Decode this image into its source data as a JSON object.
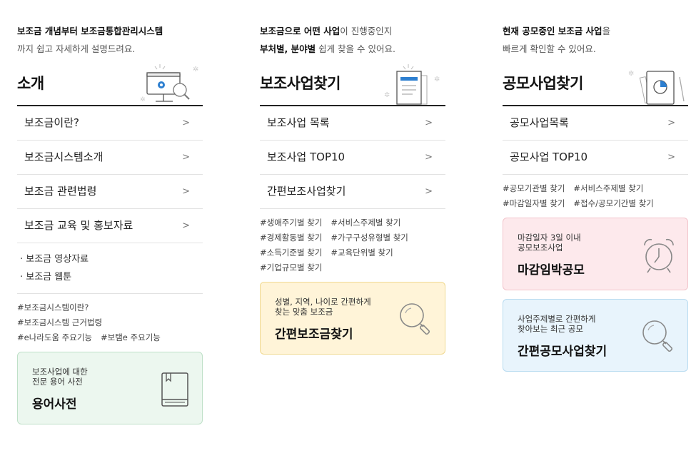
{
  "col1": {
    "intro": {
      "line1": "보조금 개념부터 보조금통합관리시스템",
      "line2": "까지 쉽고 자세하게 설명드려요."
    },
    "title": "소개",
    "menu": [
      {
        "label": "보조금이란?",
        "chevron": ">"
      },
      {
        "label": "보조금시스템소개",
        "chevron": ">"
      },
      {
        "label": "보조금 관련법령",
        "chevron": ">"
      },
      {
        "label": "보조금 교육 및 홍보자료",
        "chevron": ">"
      }
    ],
    "subitems": [
      "· 보조금 영상자료",
      "· 보조금 웹툰"
    ],
    "tags": [
      "#보조금시스템이란?",
      "#보조금시스템 근거법령",
      "#e나라도움 주요기능",
      "#보탬e 주요기능"
    ],
    "card": {
      "desc1": "보조사업에 대한",
      "desc2": "전문 용어 사전",
      "title": "용어사전",
      "icon": "book-icon"
    }
  },
  "col2": {
    "intro": {
      "line1_bold": "보조금으로 어떤 사업",
      "line1_rest": "이 진행중인지",
      "line2_bold": "부처별, 분야별",
      "line2_rest": " 쉽게 찾을 수 있어요."
    },
    "title": "보조사업찾기",
    "menu": [
      {
        "label": "보조사업 목록",
        "chevron": ">"
      },
      {
        "label": "보조사업 TOP10",
        "chevron": ">"
      },
      {
        "label": "간편보조사업찾기",
        "chevron": ">"
      }
    ],
    "tags": [
      "#생애주기별 찾기",
      "#서비스주제별 찾기",
      "#경제활동별 찾기",
      "#가구구성유형별 찾기",
      "#소득기준별 찾기",
      "#교육단위별 찾기",
      "#기업규모별 찾기"
    ],
    "card": {
      "desc1": "성별, 지역, 나이로 간편하게",
      "desc2": "찾는 맞춤 보조금",
      "title": "간편보조금찾기",
      "icon": "magnifier-icon"
    }
  },
  "col3": {
    "intro": {
      "line1_bold": "현재 공모중인 보조금 사업",
      "line1_rest": "을",
      "line2": "빠르게 확인할 수 있어요."
    },
    "title": "공모사업찾기",
    "menu": [
      {
        "label": "공모사업목록",
        "chevron": ">"
      },
      {
        "label": "공모사업 TOP10",
        "chevron": ">"
      }
    ],
    "tags": [
      "#공모기관별 찾기",
      "#서비스주제별 찾기",
      "#마감일자별 찾기",
      "#접수/공모기간별 찾기"
    ],
    "cards": [
      {
        "desc1": "마감일자 3일 이내",
        "desc2": "공모보조사업",
        "title": "마감임박공모",
        "icon": "alarm-clock-icon"
      },
      {
        "desc1": "사업주제별로 간편하게",
        "desc2": "찾아보는 최근 공모",
        "title": "간편공모사업찾기",
        "icon": "magnifier-icon"
      }
    ]
  },
  "colors": {
    "green": "#ecf7ef",
    "yellow": "#fff4d8",
    "pink": "#fde9ec",
    "blue": "#e8f4fc",
    "accent_blue": "#2d7fd0"
  }
}
